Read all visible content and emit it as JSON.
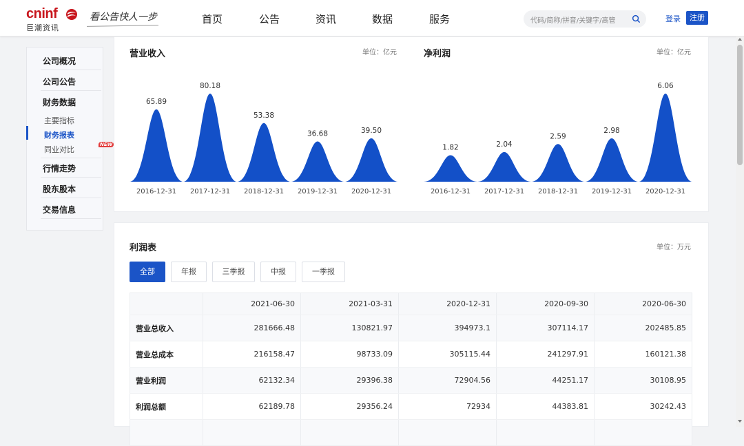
{
  "header": {
    "logo_word": "cninf",
    "logo_sub": "巨潮资讯",
    "slogan": "看公告快人一步",
    "nav": [
      "首页",
      "公告",
      "资讯",
      "数据",
      "服务"
    ],
    "search_placeholder": "代码/简称/拼音/关键字/高管",
    "login": "登录",
    "register": "注册"
  },
  "sidebar": {
    "items": [
      "公司概况",
      "公司公告",
      "财务数据",
      "行情走势",
      "股东股本",
      "交易信息"
    ],
    "sub_items": [
      "主要指标",
      "财务报表",
      "同业对比"
    ],
    "active_sub": "财务报表",
    "new_badge": "NEW"
  },
  "colors": {
    "brand_blue": "#1b54c7",
    "brand_red": "#c8161d",
    "bar_blue": "#1350c8"
  },
  "chart_data": [
    {
      "type": "area",
      "title": "营业收入",
      "unit": "单位：亿元",
      "categories": [
        "2016-12-31",
        "2017-12-31",
        "2018-12-31",
        "2019-12-31",
        "2020-12-31"
      ],
      "values": [
        65.89,
        80.18,
        53.38,
        36.68,
        39.5
      ],
      "labels": [
        "65.89",
        "80.18",
        "53.38",
        "36.68",
        "39.50"
      ]
    },
    {
      "type": "area",
      "title": "净利润",
      "unit": "单位：亿元",
      "categories": [
        "2016-12-31",
        "2017-12-31",
        "2018-12-31",
        "2019-12-31",
        "2020-12-31"
      ],
      "values": [
        1.82,
        2.04,
        2.59,
        2.98,
        6.06
      ],
      "labels": [
        "1.82",
        "2.04",
        "2.59",
        "2.98",
        "6.06"
      ]
    }
  ],
  "income": {
    "title": "利润表",
    "unit": "单位：万元",
    "tabs": [
      "全部",
      "年报",
      "三季报",
      "中报",
      "一季报"
    ],
    "active_tab": "全部",
    "columns": [
      "2021-06-30",
      "2021-03-31",
      "2020-12-31",
      "2020-09-30",
      "2020-06-30"
    ],
    "rows": [
      {
        "label": "营业总收入",
        "values": [
          "281666.48",
          "130821.97",
          "394973.1",
          "307114.17",
          "202485.85"
        ]
      },
      {
        "label": "营业总成本",
        "values": [
          "216158.47",
          "98733.09",
          "305115.44",
          "241297.91",
          "160121.38"
        ]
      },
      {
        "label": "营业利润",
        "values": [
          "62132.34",
          "29396.38",
          "72904.56",
          "44251.17",
          "30108.95"
        ]
      },
      {
        "label": "利润总额",
        "values": [
          "62189.78",
          "29356.24",
          "72934",
          "44383.81",
          "30242.43"
        ]
      },
      {
        "label": "",
        "values": [
          "",
          "",
          "",
          "",
          ""
        ]
      }
    ]
  }
}
